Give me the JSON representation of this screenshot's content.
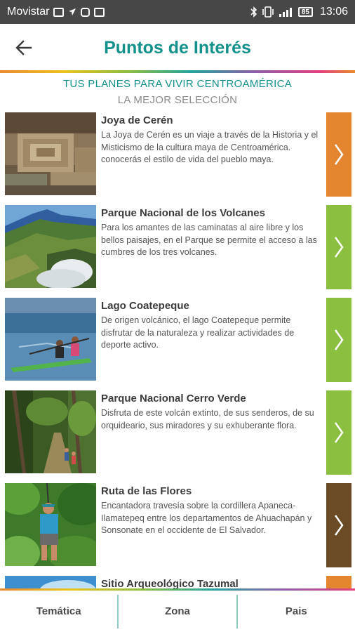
{
  "status_bar": {
    "carrier": "Movistar",
    "time": "13:06",
    "battery_level": "85"
  },
  "header": {
    "title": "Puntos de Interés",
    "back_icon": "arrow-left-icon"
  },
  "intro": {
    "tagline": "TUS PLANES PARA VIVIR CENTROAMÉRICA",
    "subtitle": "LA MEJOR SELECCIÓN"
  },
  "places": [
    {
      "title": "Joya de Cerén",
      "description": "La Joya de Cerén es un viaje a través de la Historia y el Misticismo de la cultura maya de Centroamérica. conocerás el estilo de vida del pueblo maya.",
      "accent": "#e3862f"
    },
    {
      "title": "Parque Nacional de los Volcanes",
      "description": "Para los amantes de las caminatas al aire libre y los bellos paisajes, en el Parque se permite el acceso a las cumbres de los tres volcanes.",
      "accent": "#8bbf3f"
    },
    {
      "title": "Lago Coatepeque",
      "description": "De origen volcánico, el lago Coatepeque permite disfrutar de la naturaleza y realizar actividades de deporte activo.",
      "accent": "#8bbf3f"
    },
    {
      "title": "Parque Nacional Cerro Verde",
      "description": "Disfruta de este volcán extinto, de sus senderos, de su orquideario, sus miradores y su exhuberante flora.",
      "accent": "#8bbf3f"
    },
    {
      "title": "Ruta de las Flores",
      "description": "Encantadora travesía sobre la cordillera Apaneca-Ilamatepeq entre los departamentos de Ahuachapán y Sonsonate en el occidente de El Salvador.",
      "accent": "#6b4a26"
    },
    {
      "title": "Sitio Arqueológico Tazumal",
      "description": "",
      "accent": "#e3862f"
    }
  ],
  "bottom_tabs": [
    {
      "label": "Temática"
    },
    {
      "label": "Zona"
    },
    {
      "label": "Pais"
    }
  ],
  "colors": {
    "brand": "#13918a",
    "status_bar": "#474747"
  }
}
